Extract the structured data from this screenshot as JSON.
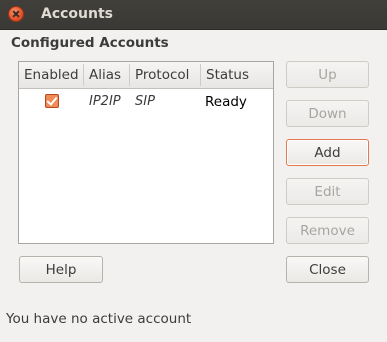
{
  "window": {
    "title": "Accounts"
  },
  "section": {
    "label": "Configured Accounts"
  },
  "table": {
    "columns": [
      "Enabled",
      "Alias",
      "Protocol",
      "Status"
    ],
    "rows": [
      {
        "enabled": true,
        "alias": "IP2IP",
        "protocol": "SIP",
        "status": "Ready"
      }
    ]
  },
  "buttons": {
    "up": "Up",
    "down": "Down",
    "add": "Add",
    "edit": "Edit",
    "remove": "Remove",
    "help": "Help",
    "close": "Close"
  },
  "status_message": "You have no active account",
  "colors": {
    "accent": "#e07b4f",
    "checkbox": "#f08a56",
    "titlebar": "#3c3b37"
  }
}
